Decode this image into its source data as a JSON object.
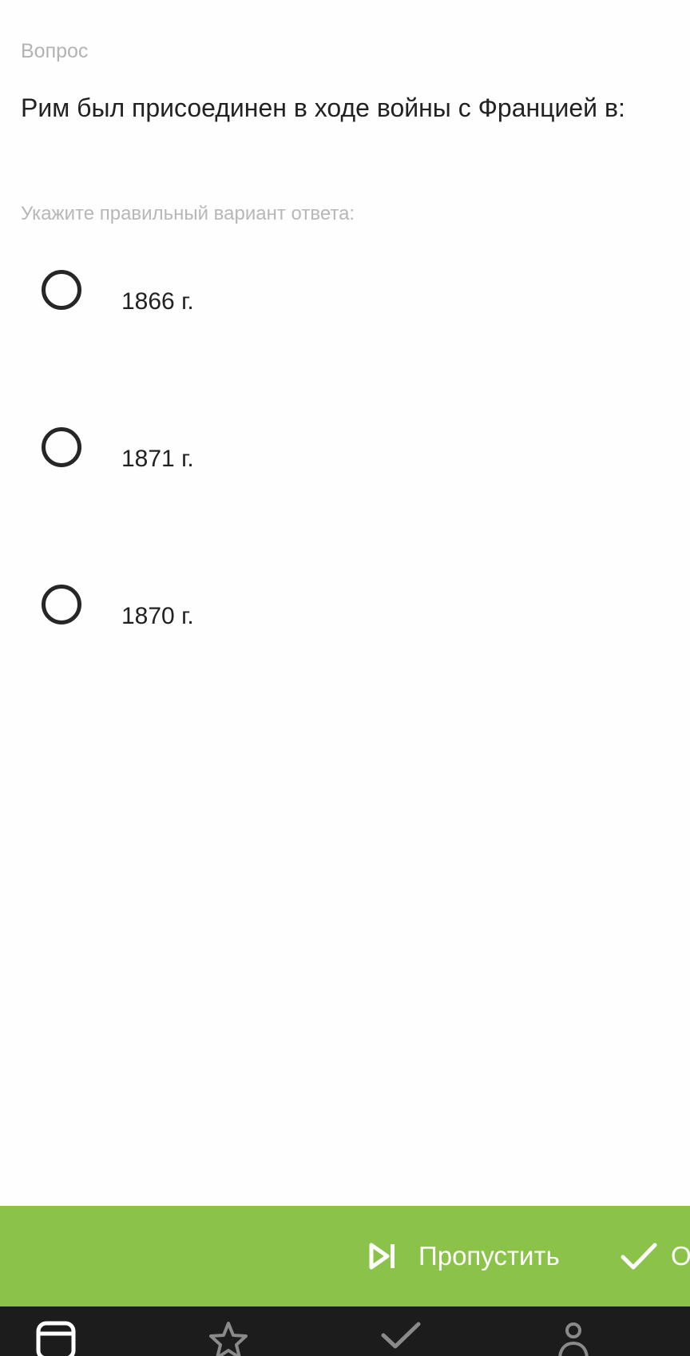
{
  "question": {
    "label": "Вопрос",
    "text": "Рим был присоединен в ходе войны с Францией в:",
    "instruction": "Укажите правильный вариант ответа:"
  },
  "options": [
    {
      "label": "1866 г.",
      "selected": false
    },
    {
      "label": "1871 г.",
      "selected": false
    },
    {
      "label": "1870 г.",
      "selected": false
    }
  ],
  "action_bar": {
    "skip_label": "Пропустить",
    "skip_icon": "skip-next-icon",
    "confirm_label": "О",
    "confirm_icon": "check-icon",
    "color": "#8bc34a"
  },
  "bottom_nav": {
    "background": "#1c1c1c",
    "items": [
      {
        "icon": "calendar-icon",
        "active": true
      },
      {
        "icon": "star-icon",
        "active": false
      },
      {
        "icon": "check-icon",
        "active": false
      },
      {
        "icon": "profile-icon",
        "active": false
      }
    ]
  }
}
